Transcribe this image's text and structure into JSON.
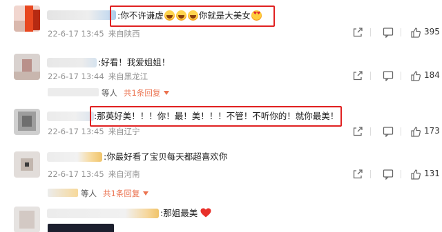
{
  "comments": [
    {
      "text": ":你不许谦虚",
      "text_after": "你就是大美女",
      "emoji_count_laugh": 3,
      "date": "22-6-17 13:45",
      "source": "来自陕西",
      "likes": "395"
    },
    {
      "text": ":好看！我爱姐姐！",
      "date": "22-6-17 13:44",
      "source": "来自黑龙江",
      "likes": "184",
      "reply_prefix": "等人",
      "reply_link": "共1条回复"
    },
    {
      "text": ":那英好美！！！你！最！美！！！不管！不听你的！就你最美！",
      "date": "22-6-17 13:45",
      "source": "来自辽宁",
      "likes": "173"
    },
    {
      "text": ":你最好看了宝贝每天都超喜欢你",
      "date": "22-6-17 13:45",
      "source": "来自河南",
      "likes": "131",
      "reply_prefix": "等人",
      "reply_link": "共1条回复"
    },
    {
      "text": ":那姐最美"
    }
  ],
  "icons": {
    "share": "share-icon",
    "comment": "comment-icon",
    "like": "thumbs-up-icon",
    "dropdown": "triangle-down-icon",
    "heart": "red-heart-emoji"
  },
  "colors": {
    "highlight_box": "#e02020",
    "reply_link": "#eb7350",
    "meta_gray": "#939393"
  }
}
